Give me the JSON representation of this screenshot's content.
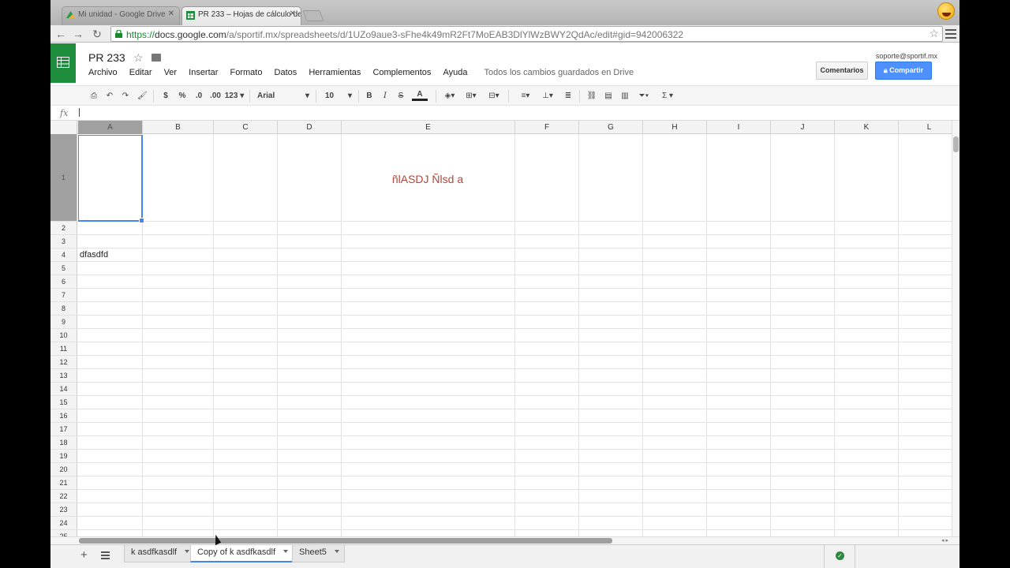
{
  "browser": {
    "tabs": [
      {
        "label": "Mi unidad - Google Drive",
        "active": false
      },
      {
        "label": "PR 233 – Hojas de cálculo de",
        "active": true
      }
    ],
    "url": {
      "scheme": "https://",
      "host": "docs.google.com",
      "path": "/a/sportif.mx/spreadsheets/d/1UZo9aue3-sFhe4k49mR2Ft7MoEAB3DlYlWzBWY2QdAc/edit#gid=942006322"
    }
  },
  "doc": {
    "title": "PR 233",
    "menus": [
      "Archivo",
      "Editar",
      "Ver",
      "Insertar",
      "Formato",
      "Datos",
      "Herramientas",
      "Complementos",
      "Ayuda"
    ],
    "status": "Todos los cambios guardados en Drive",
    "user_email": "soporte@sportif.mx",
    "comments_label": "Comentarios",
    "share_label": "Compartir",
    "share_color": "#4d90fe",
    "logo_color": "#1e8e3e"
  },
  "toolbar": {
    "currency": "$",
    "percent": "%",
    "dec_less": ".0",
    "dec_more": ".00",
    "number_format": "123",
    "font": "Arial",
    "font_size": "10",
    "bold": "B",
    "italic": "I",
    "strike": "S",
    "text_color": "A",
    "sigma": "Σ"
  },
  "formula": {
    "label": "fx",
    "value": ""
  },
  "grid": {
    "columns": [
      "A",
      "B",
      "C",
      "D",
      "E",
      "F",
      "G",
      "H",
      "I",
      "J",
      "K",
      "L"
    ],
    "row_numbers": [
      "1",
      "2",
      "3",
      "4",
      "5",
      "6",
      "7",
      "8",
      "9",
      "10",
      "11",
      "12",
      "13",
      "14",
      "15",
      "16",
      "17",
      "18",
      "19",
      "20",
      "21",
      "22",
      "23",
      "24",
      "25"
    ],
    "selected_cell": "A1",
    "cell_a4": "dfasdfd",
    "cell_e1": "ñlASDJ Ñlsd a",
    "cell_e1_color": "#b6443a"
  },
  "sheets": [
    {
      "label": "k asdfkasdlf",
      "active": false
    },
    {
      "label": "Copy of k asdfkasdlf",
      "active": true
    },
    {
      "label": "Sheet5",
      "active": false
    }
  ]
}
